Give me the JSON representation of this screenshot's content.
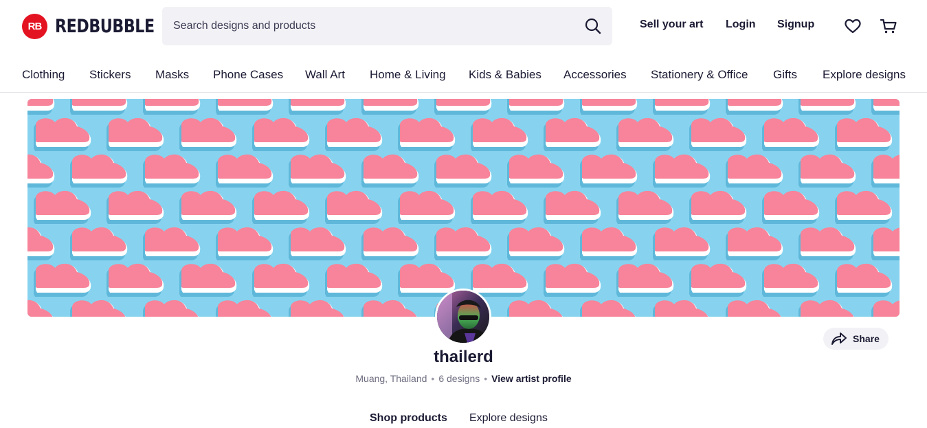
{
  "header": {
    "logo_mark": "RB",
    "logo_text": "REDBUBBLE",
    "search_placeholder": "Search designs and products",
    "sell_label": "Sell your art",
    "login_label": "Login",
    "signup_label": "Signup"
  },
  "nav": {
    "items": [
      "Clothing",
      "Stickers",
      "Masks",
      "Phone Cases",
      "Wall Art",
      "Home & Living",
      "Kids & Babies",
      "Accessories",
      "Stationery & Office",
      "Gifts",
      "Explore designs"
    ]
  },
  "profile": {
    "username": "thailerd",
    "location": "Muang, Thailand",
    "designs_count": "6 designs",
    "view_profile_label": "View artist profile",
    "share_label": "Share"
  },
  "tabs": {
    "shop_products": "Shop products",
    "explore_designs": "Explore designs"
  },
  "colors": {
    "brand_red": "#e41321",
    "text_dark": "#1b1a33",
    "banner_bg": "#87d3ef",
    "heart_pink": "#f7849a"
  }
}
